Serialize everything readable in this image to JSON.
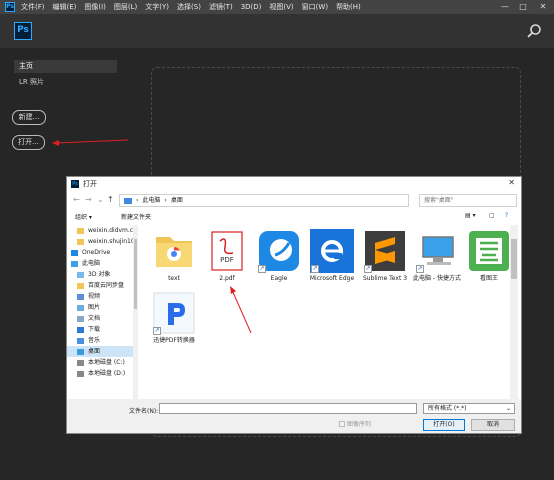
{
  "menubar": {
    "app_icon": "Ps",
    "items": [
      "文件(F)",
      "编辑(E)",
      "图像(I)",
      "图层(L)",
      "文字(Y)",
      "选择(S)",
      "滤镜(T)",
      "3D(D)",
      "视图(V)",
      "窗口(W)",
      "帮助(H)"
    ],
    "minimize": "—",
    "maximize": "□",
    "close": "✕"
  },
  "home": {
    "logo": "Ps",
    "sidebar": [
      "主页",
      "LR 照片"
    ],
    "new_button": "新建...",
    "open_button": "打开..."
  },
  "dialog": {
    "title": "打开",
    "path": [
      "此电脑",
      "桌面"
    ],
    "search_placeholder": "搜索\"桌面\"",
    "toolbar": {
      "organize": "组织 ▾",
      "new_folder": "新建文件夹"
    },
    "nav_items": [
      {
        "label": "weixin.didvm.c",
        "icon": "folder-icon"
      },
      {
        "label": "weixin.shujin10",
        "icon": "folder-icon"
      },
      {
        "label": "OneDrive",
        "icon": "cloud-icon"
      },
      {
        "label": "此电脑",
        "icon": "computer-icon"
      },
      {
        "label": "3D 对象",
        "icon": "cube-icon"
      },
      {
        "label": "百度云同步盘",
        "icon": "folder-icon"
      },
      {
        "label": "视频",
        "icon": "video-icon"
      },
      {
        "label": "图片",
        "icon": "picture-icon"
      },
      {
        "label": "文档",
        "icon": "document-icon"
      },
      {
        "label": "下载",
        "icon": "download-icon"
      },
      {
        "label": "音乐",
        "icon": "music-icon"
      },
      {
        "label": "桌面",
        "icon": "desktop-icon",
        "selected": true
      },
      {
        "label": "本地磁盘 (C:)",
        "icon": "drive-icon"
      },
      {
        "label": "本地磁盘 (D:)",
        "icon": "drive-icon"
      }
    ],
    "files": [
      {
        "label": "text",
        "icon": "folder-icon"
      },
      {
        "label": "2.pdf",
        "icon": "pdf-icon"
      },
      {
        "label": "Eagle",
        "icon": "eagle-icon"
      },
      {
        "label": "Microsoft Edge",
        "icon": "edge-icon"
      },
      {
        "label": "Sublime Text 3",
        "icon": "sublime-icon"
      },
      {
        "label": "此电脑 - 快捷方式",
        "icon": "computer-icon"
      },
      {
        "label": "看图王",
        "icon": "image-viewer-icon"
      },
      {
        "label": "迅捷PDF转换器",
        "icon": "pdf-converter-icon"
      }
    ],
    "pdf_badge": "PDF",
    "filename_label": "文件名(N):",
    "filename_value": "",
    "filetype": "所有格式 (*.*)",
    "readonly_label": "图像序列",
    "open_label": "打开(O)",
    "cancel_label": "取消",
    "colors": {
      "accent": "#0078d7",
      "annotation": "#e02020",
      "ps_blue": "#31a8ff"
    }
  }
}
